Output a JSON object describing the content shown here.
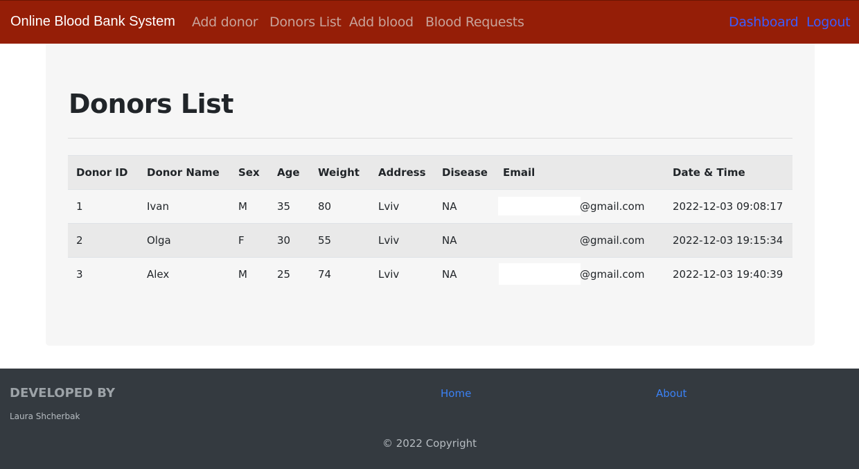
{
  "navbar": {
    "brand": "Online Blood Bank System",
    "links": [
      "Add donor",
      "Donors List",
      "Add blood",
      "Blood Requests"
    ],
    "right_links": [
      "Dashboard",
      "Logout"
    ],
    "bg_color": "#951e07"
  },
  "main": {
    "title": "Donors List",
    "table": {
      "headers": [
        "Donor ID",
        "Donor Name",
        "Sex",
        "Age",
        "Weight",
        "Address",
        "Disease",
        "Email",
        "Date & Time"
      ],
      "rows": [
        [
          "1",
          "Ivan",
          "M",
          "35",
          "80",
          "Lviv",
          "NA",
          "@gmail.com",
          "2022-12-03 09:08:17"
        ],
        [
          "2",
          "Olga",
          "F",
          "30",
          "55",
          "Lviv",
          "NA",
          "@gmail.com",
          "2022-12-03 19:15:34"
        ],
        [
          "3",
          "Alex",
          "M",
          "25",
          "74",
          "Lviv",
          "NA",
          "@gmail.com",
          "2022-12-03 19:40:39"
        ]
      ]
    }
  },
  "footer": {
    "developed_by_title": "DEVELOPED BY",
    "developer_name": "Laura Shcherbak",
    "links": [
      "Home",
      "About"
    ],
    "copyright": "© 2022 Copyright"
  }
}
